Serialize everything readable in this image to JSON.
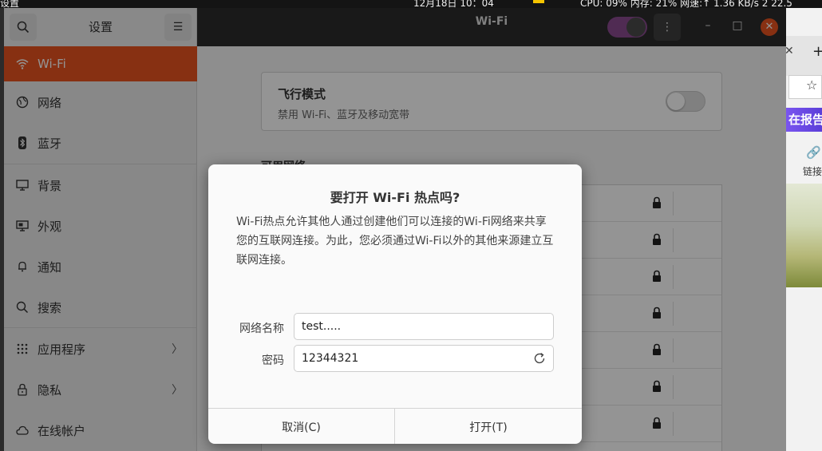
{
  "top_panel": {
    "left_text": "设置",
    "clock": "12月18日 10：04",
    "stats": "CPU: 09% 内存: 21% 网速:↑  1.36 KB/s  2  22.5"
  },
  "browser": {
    "banner_text": "在报告",
    "link_label": "链接"
  },
  "window": {
    "sidebar_title": "设置",
    "page_title": "Wi-Fi",
    "accent_color": "#e95420"
  },
  "sidebar": {
    "items": [
      {
        "label": "Wi-Fi",
        "icon": "wifi-icon",
        "active": true
      },
      {
        "label": "网络",
        "icon": "network-icon"
      },
      {
        "label": "蓝牙",
        "icon": "bluetooth-icon"
      },
      {
        "label": "背景",
        "icon": "background-icon"
      },
      {
        "label": "外观",
        "icon": "appearance-icon"
      },
      {
        "label": "通知",
        "icon": "bell-icon"
      },
      {
        "label": "搜索",
        "icon": "search-icon"
      },
      {
        "label": "应用程序",
        "icon": "apps-grid-icon",
        "has_submenu": true
      },
      {
        "label": "隐私",
        "icon": "lock-icon",
        "has_submenu": true
      },
      {
        "label": "在线帐户",
        "icon": "cloud-icon"
      }
    ]
  },
  "main": {
    "airplane_title": "飞行模式",
    "airplane_subtitle": "禁用 Wi-Fi、蓝牙及移动宽带",
    "airplane_enabled": false,
    "visible_networks_title": "可用网络"
  },
  "dialog": {
    "title": "要打开 Wi-Fi 热点吗?",
    "body": "Wi-Fi热点允许其他人通过创建他们可以连接的Wi-Fi网络来共享您的互联网连接。为此，您必须通过Wi-Fi以外的其他来源建立互联网连接。",
    "network_name_label": "网络名称",
    "network_name_value": "test.....",
    "password_label": "密码",
    "password_value": "12344321",
    "cancel_label": "取消(C)",
    "ok_label": "打开(T)"
  }
}
